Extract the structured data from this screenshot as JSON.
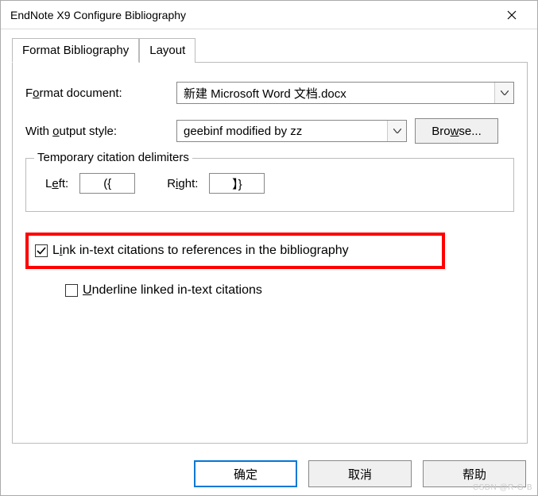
{
  "window": {
    "title": "EndNote X9 Configure Bibliography"
  },
  "tabs": {
    "active": "Format Bibliography",
    "inactive": "Layout"
  },
  "form": {
    "format_label_pre": "F",
    "format_label_u": "o",
    "format_label_post": "rmat document:",
    "format_value": "新建 Microsoft Word 文档.docx",
    "style_label_pre": "With ",
    "style_label_u": "o",
    "style_label_post": "utput style:",
    "style_value": "geebinf modified by zz",
    "browse_pre": "Bro",
    "browse_u": "w",
    "browse_post": "se..."
  },
  "delimiters": {
    "legend": "Temporary citation delimiters",
    "left_pre": "L",
    "left_u": "e",
    "left_post": "ft:",
    "left_value": "({",
    "right_pre": "R",
    "right_u": "i",
    "right_post": "ght:",
    "right_value": "】}"
  },
  "checkboxes": {
    "link_pre": "L",
    "link_u": "i",
    "link_post": "nk in-text citations to references in the bibliography",
    "link_checked": true,
    "underline_pre": "",
    "underline_u": "U",
    "underline_post": "nderline linked in-text citations",
    "underline_checked": false
  },
  "buttons": {
    "ok": "确定",
    "cancel": "取消",
    "help": "帮助"
  },
  "watermark": "CSDN @R·G·B"
}
